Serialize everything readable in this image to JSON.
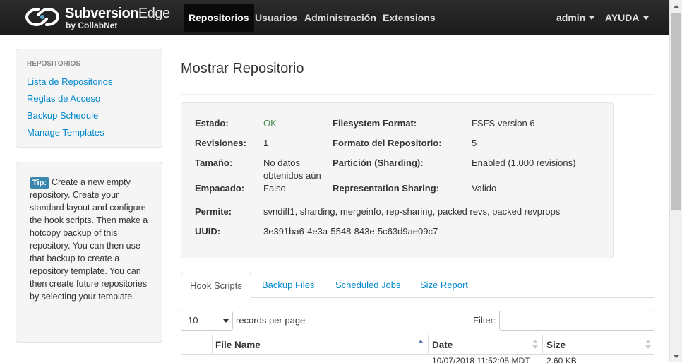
{
  "brand": {
    "name_main": "Subversion",
    "name_edge": "Edge",
    "sub": "by CollabNet"
  },
  "nav": {
    "items": [
      "Repositorios",
      "Usuarios",
      "Administración",
      "Extensions"
    ],
    "user": "admin",
    "help": "AYUDA"
  },
  "sidebar": {
    "header": "REPOSITORIOS",
    "links": [
      "Lista de Repositorios",
      "Reglas de Acceso",
      "Backup Schedule",
      "Manage Templates"
    ],
    "tip_label": "Tip:",
    "tip_text": "Create a new empty repository. Create your standard layout and configure the hook scripts. Then make a hotcopy backup of this repository. You can then use that backup to create a repository template. You can then create future repositories by selecting your template."
  },
  "page": {
    "title": "Mostrar Repositorio"
  },
  "info": {
    "estado_label": "Estado:",
    "estado_value": "OK",
    "revisiones_label": "Revisiones:",
    "revisiones_value": "1",
    "tamano_label": "Tamaño:",
    "tamano_value_1": "No datos",
    "tamano_value_2": "obtenidos aún",
    "empacado_label": "Empacado:",
    "empacado_value": "Falso",
    "fs_label": "Filesystem Format:",
    "fs_value": "FSFS version 6",
    "formato_label": "Formato del Repositorio:",
    "formato_value": "5",
    "particion_label": "Partición (Sharding):",
    "particion_value": "Enabled (1.000 revisions)",
    "repshare_label": "Representation Sharing:",
    "repshare_value": "Valido",
    "permite_label": "Permite:",
    "permite_value": "svndiff1, sharding, mergeinfo, rep-sharing, packed revs, packed revprops",
    "uuid_label": "UUID:",
    "uuid_value": "3e391ba6-4e3a-5548-843e-5c63d9ae09c7"
  },
  "tabs": [
    "Hook Scripts",
    "Backup Files",
    "Scheduled Jobs",
    "Size Report"
  ],
  "table_controls": {
    "page_size": "10",
    "records_label": "records per page",
    "filter_label": "Filter:",
    "filter_value": ""
  },
  "table": {
    "columns": [
      "File Name",
      "Date",
      "Size"
    ],
    "partial_row": {
      "name": "",
      "date": "10/07/2018 11:52:05 MDT",
      "size": "2.60 KB"
    }
  }
}
